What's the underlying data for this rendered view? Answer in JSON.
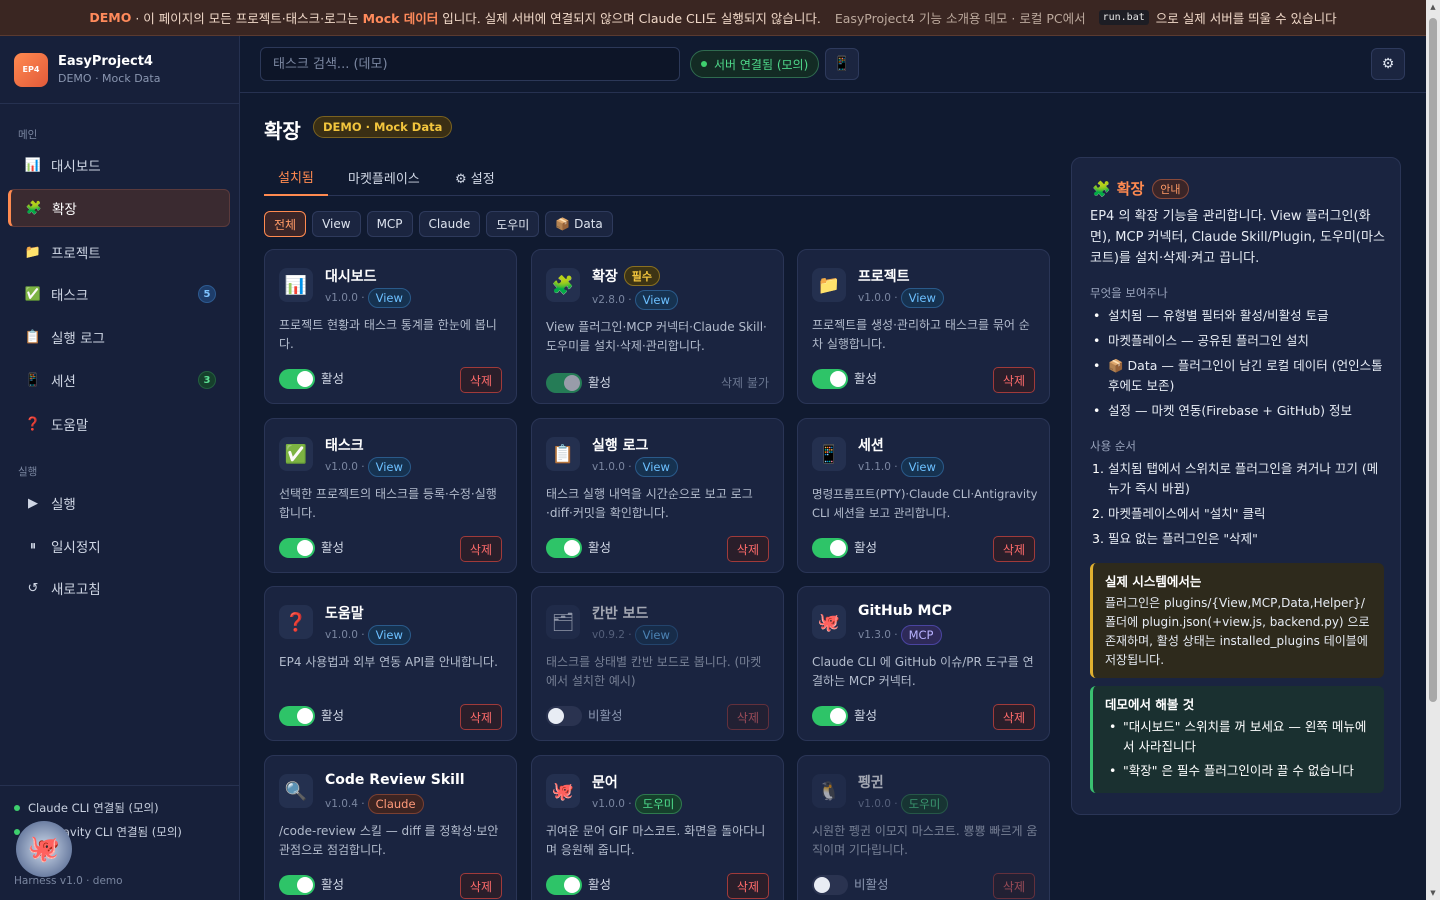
{
  "banner": {
    "demo": "DEMO",
    "text1": "· 이 페이지의 모든 프로젝트·태스크·로그는",
    "mock": "Mock 데이터",
    "text2": "입니다. 실제 서버에 연결되지 않으며 Claude CLI도 실행되지 않습니다.",
    "text3": "EasyProject4 기능 소개용 데모 · 로컬 PC에서",
    "code": "run.bat",
    "text4": "으로 실제 서버를 띄울 수 있습니다"
  },
  "brand": {
    "logo": "EP4",
    "name": "EasyProject4",
    "sub": "DEMO · Mock Data"
  },
  "sidebar": {
    "section_main": "메인",
    "section_run": "실행",
    "main_items": [
      {
        "icon": "📊",
        "label": "대시보드"
      },
      {
        "icon": "🧩",
        "label": "확장"
      },
      {
        "icon": "📁",
        "label": "프로젝트"
      },
      {
        "icon": "✅",
        "label": "태스크",
        "badge": "5"
      },
      {
        "icon": "📋",
        "label": "실행 로그"
      },
      {
        "icon": "📱",
        "label": "세션",
        "badge": "3"
      },
      {
        "icon": "❓",
        "label": "도움말"
      }
    ],
    "run_items": [
      {
        "icon": "▶",
        "label": "실행"
      },
      {
        "icon": "⏸",
        "label": "일시정지"
      },
      {
        "icon": "↺",
        "label": "새로고침"
      }
    ],
    "footer": {
      "claude": "Claude CLI 연결됨 (모의)",
      "antigravity": "Antigravity CLI 연결됨 (모의)",
      "version": "Harness v1.0 · demo"
    }
  },
  "topbar": {
    "search_placeholder": "태스크 검색... (데모)",
    "server_status": "서버 연결됨 (모의)"
  },
  "page": {
    "title": "확장",
    "badge": "DEMO · Mock Data"
  },
  "tabs": [
    "설치됨",
    "마켓플레이스",
    "⚙ 설정"
  ],
  "filters": [
    "전체",
    "View",
    "MCP",
    "Claude",
    "도우미",
    "📦 Data"
  ],
  "cards": [
    {
      "icon": "📊",
      "name": "대시보드",
      "version": "v1.0.0 ·",
      "tag": "View",
      "desc": "프로젝트 현황과 태스크 통계를 한눈에 봅니다.",
      "status": "활성",
      "action": "삭제"
    },
    {
      "icon": "🧩",
      "name": "확장",
      "required": "필수",
      "version": "v2.8.0 ·",
      "tag": "View",
      "desc": "View 플러그인·MCP 커넥터·Claude Skill·도우미를 설치·삭제·관리합니다.",
      "status": "활성",
      "action": "삭제 불가"
    },
    {
      "icon": "📁",
      "name": "프로젝트",
      "version": "v1.0.0 ·",
      "tag": "View",
      "desc": "프로젝트를 생성·관리하고 태스크를 묶어 순차 실행합니다.",
      "status": "활성",
      "action": "삭제"
    },
    {
      "icon": "✅",
      "name": "태스크",
      "version": "v1.0.0 ·",
      "tag": "View",
      "desc": "선택한 프로젝트의 태스크를 등록·수정·실행합니다.",
      "status": "활성",
      "action": "삭제"
    },
    {
      "icon": "📋",
      "name": "실행 로그",
      "version": "v1.0.0 ·",
      "tag": "View",
      "desc": "태스크 실행 내역을 시간순으로 보고 로그·diff·커밋을 확인합니다.",
      "status": "활성",
      "action": "삭제"
    },
    {
      "icon": "📱",
      "name": "세션",
      "version": "v1.1.0 ·",
      "tag": "View",
      "desc": "명령프롬프트(PTY)·Claude CLI·Antigravity CLI 세션을 보고 관리합니다.",
      "status": "활성",
      "action": "삭제"
    },
    {
      "icon": "❓",
      "name": "도움말",
      "version": "v1.0.0 ·",
      "tag": "View",
      "desc": "EP4 사용법과 외부 연동 API를 안내합니다.",
      "status": "활성",
      "action": "삭제"
    },
    {
      "icon": "🗂",
      "name": "칸반 보드",
      "version": "v0.9.2 ·",
      "tag": "View",
      "desc": "태스크를 상태별 칸반 보드로 봅니다. (마켓에서 설치한 예시)",
      "status": "비활성",
      "action": "삭제"
    },
    {
      "icon": "🐙",
      "name": "GitHub MCP",
      "version": "v1.3.0 ·",
      "tag": "MCP",
      "desc": "Claude CLI 에 GitHub 이슈/PR 도구를 연결하는 MCP 커넥터.",
      "status": "활성",
      "action": "삭제"
    },
    {
      "icon": "🔍",
      "name": "Code Review Skill",
      "version": "v1.0.4 ·",
      "tag": "Claude",
      "desc": "/code-review 스킬 — diff 를 정확성·보안 관점으로 점검합니다.",
      "status": "활성",
      "action": "삭제"
    },
    {
      "icon": "🐙",
      "name": "문어",
      "version": "v1.0.0 ·",
      "tag": "도우미",
      "desc": "귀여운 문어 GIF 마스코트. 화면을 돌아다니며 응원해 줍니다.",
      "status": "활성",
      "action": "삭제"
    },
    {
      "icon": "🐧",
      "name": "펭귄",
      "version": "v1.0.0 ·",
      "tag": "도우미",
      "desc": "시원한 펭귄 이모지 마스코트. 뿅뿅 빠르게 움직이며 기다립니다.",
      "status": "비활성",
      "action": "삭제"
    }
  ],
  "info": {
    "title": "확장",
    "badge": "안내",
    "intro": "EP4 의 확장 기능을 관리합니다. View 플러그인(화면), MCP 커넥터, Claude Skill/Plugin, 도우미(마스코트)를 설치·삭제·켜고 끕니다.",
    "shows_title": "무엇을 보여주나",
    "shows": [
      "설치됨 — 유형별 필터와 활성/비활성 토글",
      "마켓플레이스 — 공유된 플러그인 설치",
      "📦 Data — 플러그인이 남긴 로컬 데이터 (언인스톨 후에도 보존)",
      "설정 — 마켓 연동(Firebase + GitHub) 정보"
    ],
    "order_title": "사용 순서",
    "order": [
      "설치됨 탭에서 스위치로 플러그인을 켜거나 끄기 (메뉴가 즉시 바뀜)",
      "마켓플레이스에서 \"설치\" 클릭",
      "필요 없는 플러그인은 \"삭제\""
    ],
    "real_title": "실제 시스템에서는",
    "real_body": "플러그인은 plugins/{View,MCP,Data,Helper}/ 폴더에 plugin.json(+view.js, backend.py) 으로 존재하며, 활성 상태는 installed_plugins 테이블에 저장됩니다.",
    "try_title": "데모에서 해볼 것",
    "try": [
      "\"대시보드\" 스위치를 꺼 보세요 — 왼쪽 메뉴에서 사라집니다",
      "\"확장\" 은 필수 플러그인이라 끌 수 없습니다"
    ]
  }
}
